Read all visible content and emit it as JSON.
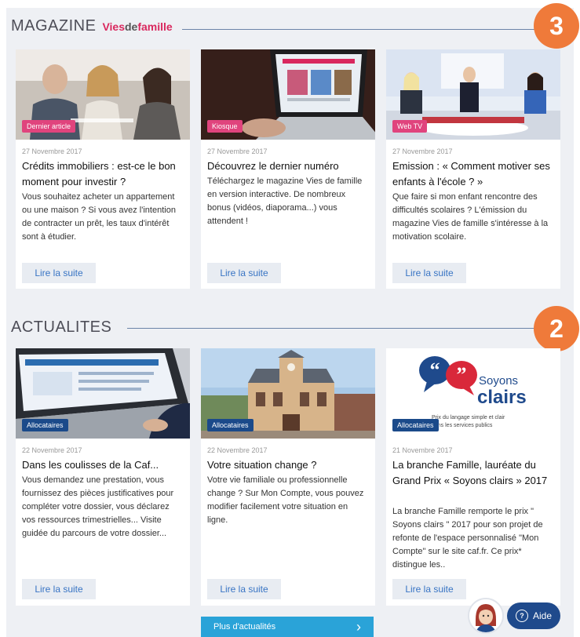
{
  "magazine": {
    "title": "MAGAZINE",
    "brand_part1": "Vies",
    "brand_part2": "de",
    "brand_part3": "famille",
    "badge": "3",
    "cards": [
      {
        "tag": "Dernier article",
        "date": "27 Novembre 2017",
        "title": "Crédits immobiliers : est-ce le bon moment pour investir ?",
        "desc": "Vous souhaitez acheter un appartement ou une maison ? Si vous avez l'intention de contracter un prêt, les taux d'intérêt sont à étudier.",
        "button": "Lire la suite"
      },
      {
        "tag": "Kiosque",
        "date": "27 Novembre 2017",
        "title": "Découvrez le dernier numéro",
        "desc": "Téléchargez le magazine Vies de famille en version interactive. De nombreux bonus (vidéos, diaporama...) vous attendent !",
        "button": "Lire la suite"
      },
      {
        "tag": "Web TV",
        "date": "27 Novembre 2017",
        "title": "Emission : « Comment motiver ses enfants à l'école ? »",
        "desc": "Que faire si mon enfant rencontre des difficultés scolaires ? L'émission du magazine Vies de famille s'intéresse à la motivation scolaire.",
        "button": "Lire la suite"
      }
    ]
  },
  "actualites": {
    "title": "ACTUALITES",
    "badge": "2",
    "cards": [
      {
        "tag": "Allocataires",
        "date": "22 Novembre 2017",
        "title": "Dans les coulisses de la Caf...",
        "desc": "Vous demandez une prestation, vous fournissez des pièces justificatives pour compléter votre dossier, vous déclarez vos ressources trimestrielles... Visite guidée du parcours de votre dossier...",
        "button": "Lire la suite"
      },
      {
        "tag": "Allocataires",
        "date": "22 Novembre 2017",
        "title": "Votre situation change ?",
        "desc": "Votre vie familiale ou professionnelle change ? Sur Mon Compte, vous pouvez modifier facilement votre situation en ligne.",
        "button": "Lire la suite"
      },
      {
        "tag": "Allocataires",
        "date": "21 Novembre 2017",
        "title": "La branche Famille, lauréate du Grand Prix « Soyons clairs » 2017",
        "desc": "La branche Famille remporte le prix \" Soyons clairs \" 2017 pour son projet de refonte de l'espace personnalisé \"Mon Compte\" sur le site caf.fr. Ce prix* distingue les..",
        "button": "Lire la suite"
      }
    ],
    "logo_text": {
      "quote_left": "“",
      "quote_right": "”",
      "line1": "Soyons",
      "line2": "clairs",
      "sub1": "Prix du langage simple et clair",
      "sub2": "dans les services publics"
    }
  },
  "more_button": {
    "label": "Plus d'actualités",
    "chevron": "›"
  },
  "help": {
    "icon_glyph": "?",
    "label": "Aide"
  },
  "colors": {
    "badge": "#ef7a3a",
    "tag_pink": "#e0447d",
    "tag_blue": "#1b4a8a",
    "link": "#3874c4",
    "more_button": "#2aa3d8",
    "help_button": "#1f4a8c"
  }
}
